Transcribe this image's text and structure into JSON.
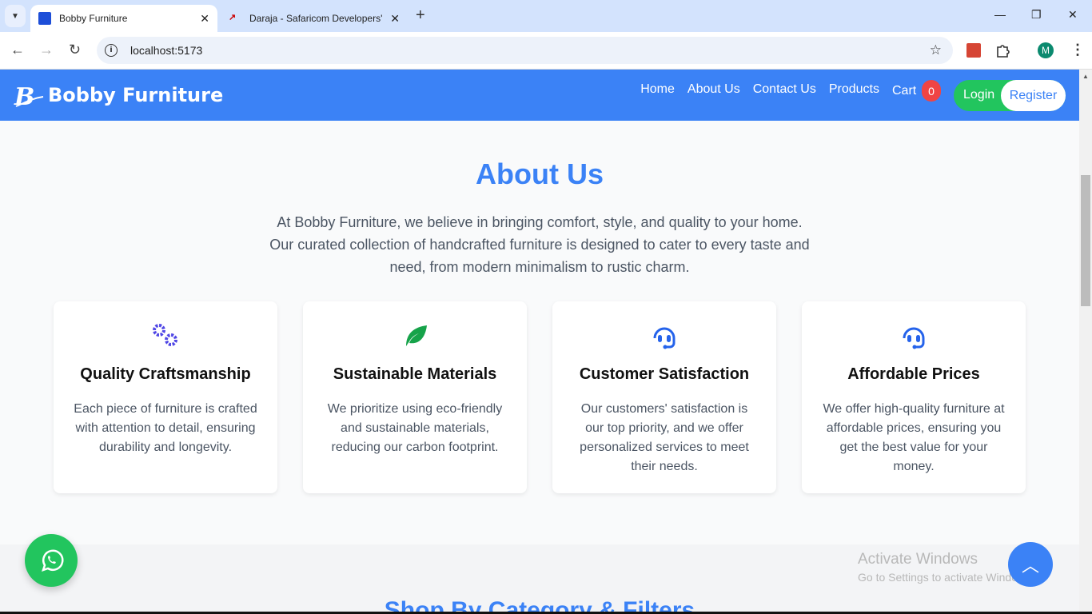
{
  "browser": {
    "tabs": [
      {
        "title": "Bobby Furniture",
        "active": true
      },
      {
        "title": "Daraja - Safaricom Developers'",
        "active": false
      }
    ],
    "url": "localhost:5173",
    "profile_initial": "M",
    "scroll_fraction": 0.24
  },
  "header": {
    "brand": "Bobby Furniture",
    "nav": [
      "Home",
      "About Us",
      "Contact Us",
      "Products"
    ],
    "cart_label": "Cart",
    "cart_count": "0",
    "login": "Login",
    "register": "Register"
  },
  "about": {
    "title": "About Us",
    "intro": "At Bobby Furniture, we believe in bringing comfort, style, and quality to your home. Our curated collection of handcrafted furniture is designed to cater to every taste and need, from modern minimalism to rustic charm.",
    "features": [
      {
        "icon": "gears-icon",
        "title": "Quality Craftsmanship",
        "text": "Each piece of furniture is crafted with attention to detail, ensuring durability and longevity."
      },
      {
        "icon": "leaf-icon",
        "title": "Sustainable Materials",
        "text": "We prioritize using eco-friendly and sustainable materials, reducing our carbon footprint."
      },
      {
        "icon": "headset-icon",
        "title": "Customer Satisfaction",
        "text": "Our customers' satisfaction is our top priority, and we offer personalized services to meet their needs."
      },
      {
        "icon": "headset-icon",
        "title": "Affordable Prices",
        "text": "We offer high-quality furniture at affordable prices, ensuring you get the best value for your money."
      }
    ]
  },
  "shop_title": "Shop By Category & Filters",
  "watermark": {
    "line1": "Activate Windows",
    "line2": "Go to Settings to activate Windows"
  },
  "colors": {
    "primary": "#3b82f6",
    "green": "#22c55e",
    "badge": "#ef4444",
    "gears": "#4f46e5",
    "leaf": "#16a34a",
    "headset": "#2563eb"
  }
}
